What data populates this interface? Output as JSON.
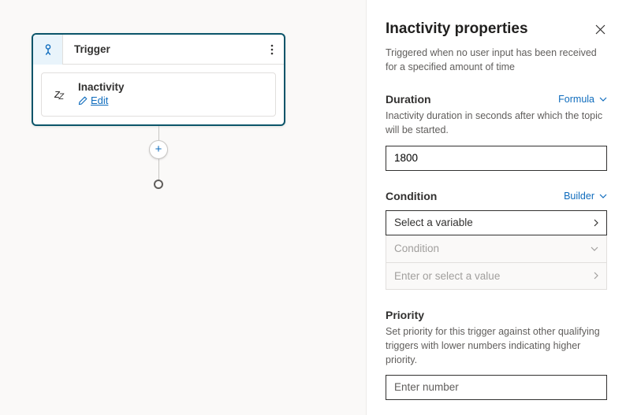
{
  "canvas": {
    "node": {
      "title": "Trigger",
      "sub": {
        "title": "Inactivity",
        "editLabel": "Edit"
      }
    }
  },
  "panel": {
    "title": "Inactivity properties",
    "desc": "Triggered when no user input has been received for a specified amount of time",
    "duration": {
      "label": "Duration",
      "mode": "Formula",
      "help": "Inactivity duration in seconds after which the topic will be started.",
      "value": "1800"
    },
    "condition": {
      "label": "Condition",
      "mode": "Builder",
      "variablePlaceholder": "Select a variable",
      "conditionPlaceholder": "Condition",
      "valuePlaceholder": "Enter or select a value"
    },
    "priority": {
      "label": "Priority",
      "help": "Set priority for this trigger against other qualifying triggers with lower numbers indicating higher priority.",
      "placeholder": "Enter number"
    }
  }
}
